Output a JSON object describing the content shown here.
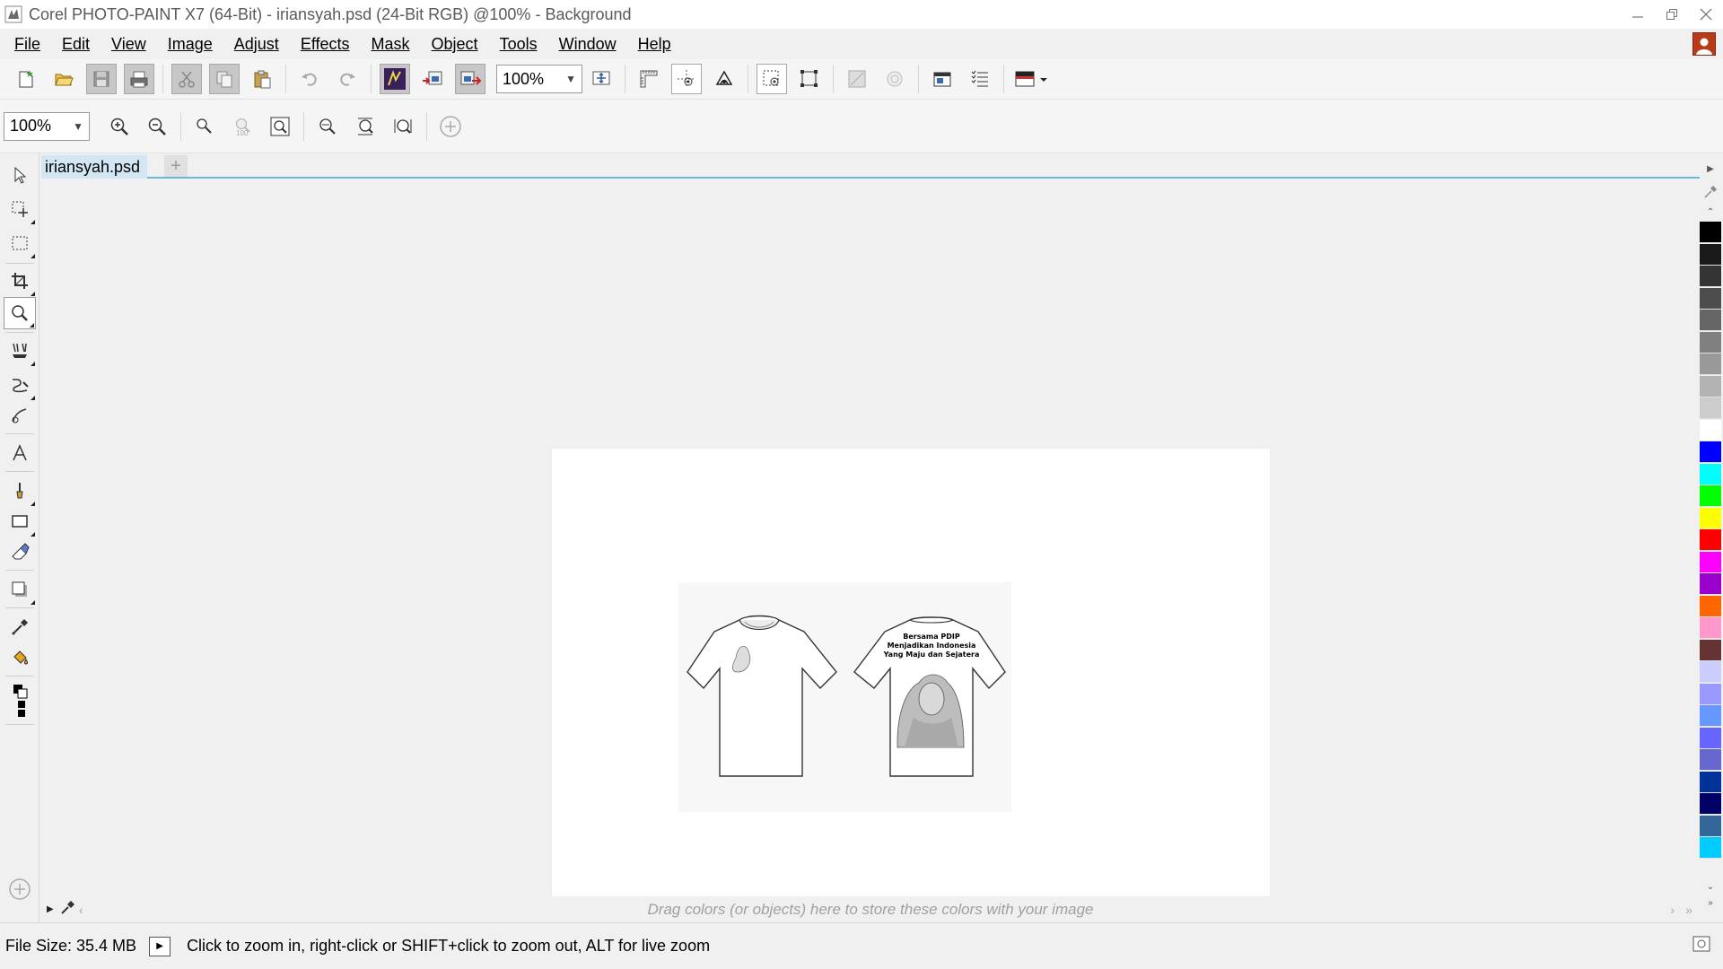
{
  "window": {
    "title": "Corel PHOTO-PAINT X7 (64-Bit) - iriansyah.psd (24-Bit RGB) @100% - Background"
  },
  "menu": {
    "items": [
      {
        "label": "File",
        "name": "menu-file"
      },
      {
        "label": "Edit",
        "name": "menu-edit"
      },
      {
        "label": "View",
        "name": "menu-view"
      },
      {
        "label": "Image",
        "name": "menu-image"
      },
      {
        "label": "Adjust",
        "name": "menu-adjust"
      },
      {
        "label": "Effects",
        "name": "menu-effects"
      },
      {
        "label": "Mask",
        "name": "menu-mask"
      },
      {
        "label": "Object",
        "name": "menu-object"
      },
      {
        "label": "Tools",
        "name": "menu-tools"
      },
      {
        "label": "Window",
        "name": "menu-window"
      },
      {
        "label": "Help",
        "name": "menu-help"
      }
    ]
  },
  "toolbar": {
    "zoom_value": "100%"
  },
  "zoom_toolbar": {
    "zoom_value": "100%",
    "actual_size_label": "100"
  },
  "document": {
    "tab_label": "iriansyah.psd",
    "shirt_text": [
      "Bersama PDIP",
      "Menjadikan Indonesia",
      "Yang Maju dan Sejatera"
    ]
  },
  "color_well": {
    "hint": "Drag colors (or objects) here to store these colors with your image"
  },
  "status": {
    "file_size": "File Size: 35.4 MB",
    "hint": "Click to zoom in, right-click or SHIFT+click to zoom out, ALT for live zoom"
  },
  "palette": {
    "colors": [
      "#000000",
      "#1a1a1a",
      "#333333",
      "#4d4d4d",
      "#666666",
      "#808080",
      "#999999",
      "#b3b3b3",
      "#cccccc",
      "#ffffff",
      "#0000ff",
      "#00ffff",
      "#00ff00",
      "#ffff00",
      "#ff0000",
      "#ff00ff",
      "#9900cc",
      "#ff6600",
      "#ff99cc",
      "#663333",
      "#ccccff",
      "#9999ff",
      "#6699ff",
      "#6666ff",
      "#6666cc",
      "#003399",
      "#000066",
      "#336699",
      "#00ccff"
    ]
  },
  "icons": {
    "title": "corel-app-icon",
    "user": "user-icon"
  }
}
